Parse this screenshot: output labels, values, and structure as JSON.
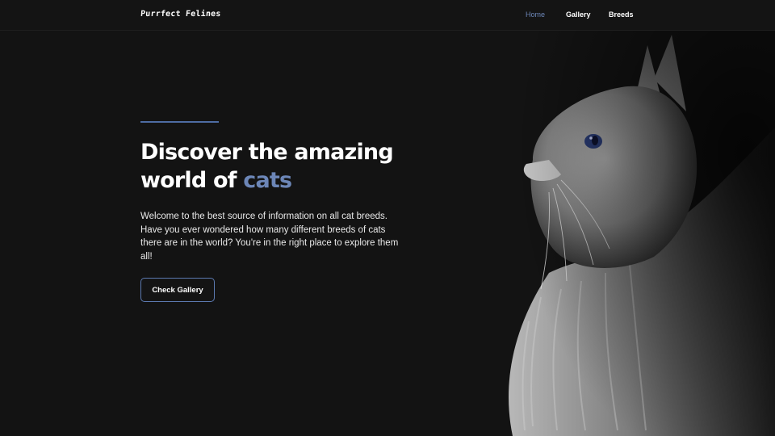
{
  "app": {
    "logo_text": "Purrfect Felines"
  },
  "nav": {
    "items": [
      {
        "label": "Home",
        "active": true
      },
      {
        "label": "Gallery",
        "active": false
      },
      {
        "label": "Breeds",
        "active": false
      }
    ]
  },
  "hero": {
    "headline_line1": "Discover the amazing",
    "headline_line2_prefix": "world of ",
    "headline_highlight": "cats",
    "intro": "Welcome to the best source of information on all cat breeds. Have you ever wondered how many different breeds of cats there are in the world? You're in the right place to explore them all!",
    "cta_label": "Check Gallery"
  },
  "colors": {
    "background": "#131313",
    "accent": "#6c86b7",
    "accent_line": "#4e6ca3",
    "text": "#ffffff"
  },
  "image": {
    "subject": "cat-portrait-icon"
  }
}
